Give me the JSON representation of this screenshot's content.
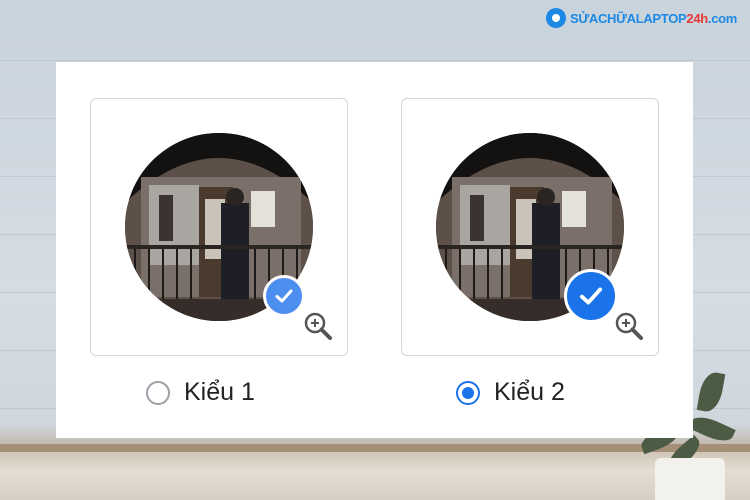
{
  "logo": {
    "text_main": "SỬACHỮALAPTOP",
    "text_accent": "24h",
    "text_domain": ".com"
  },
  "options": [
    {
      "label": "Kiểu 1",
      "selected": false,
      "check_style": "light-blue-small"
    },
    {
      "label": "Kiểu 2",
      "selected": true,
      "check_style": "blue-large"
    }
  ],
  "icons": {
    "check": "checkmark-icon",
    "zoom": "zoom-in-icon",
    "radio_unselected": "radio-unchecked-icon",
    "radio_selected": "radio-checked-icon"
  },
  "colors": {
    "accent": "#1a73e8",
    "check_light": "#4d8ff0",
    "radio_off": "#9aa0a6",
    "logo_blue": "#1e88e5",
    "logo_red": "#e53935"
  }
}
